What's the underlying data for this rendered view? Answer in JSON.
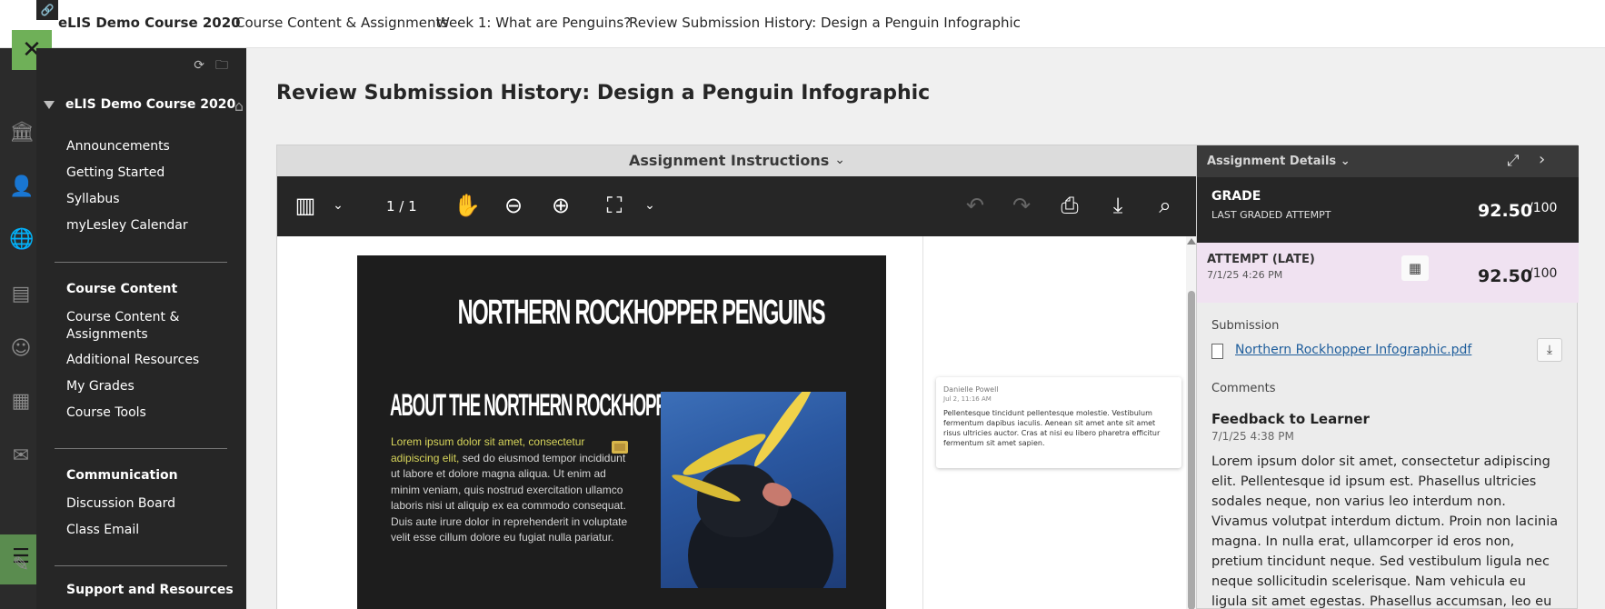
{
  "topbar": {
    "link_icon": "link-icon",
    "course": "eLIS Demo Course 2020",
    "crumbs": [
      "Course Content & Assignments",
      "Week 1: What are Penguins?",
      "Review Submission History: Design a Penguin Infographic"
    ]
  },
  "rail": {
    "icons": [
      "institution-icon",
      "profile-icon",
      "globe-icon",
      "activity-stream-icon",
      "groups-icon",
      "calendar-icon",
      "messages-icon",
      "courses-icon",
      "grades-icon"
    ],
    "close_glyph": "✕"
  },
  "menu": {
    "title": "eLIS Demo Course 2020",
    "items_top": [
      "Announcements",
      "Getting Started",
      "Syllabus",
      "myLesley Calendar"
    ],
    "section_course_content": "Course Content",
    "items_course_content": [
      "Course Content & Assignments",
      "Additional Resources",
      "My Grades",
      "Course Tools"
    ],
    "section_communication": "Communication",
    "items_communication": [
      "Discussion Board",
      "Class Email"
    ],
    "section_support": "Support and Resources"
  },
  "main": {
    "page_title": "Review Submission History: Design a Penguin Infographic"
  },
  "viewer": {
    "instructions_label": "Assignment Instructions",
    "page_indicator": "1 / 1",
    "poster": {
      "title": "NORTHERN ROCKHOPPER PENGUINS",
      "subtitle": "ABOUT THE NORTHERN ROCKHOPPER",
      "highlighted": "Lorem ipsum dolor sit amet, consectetur adipiscing elit,",
      "body": " sed do eiusmod tempor incididunt ut labore et dolore magna aliqua. Ut enim ad minim veniam, quis nostrud exercitation ullamco laboris nisi ut aliquip ex ea commodo consequat. Duis aute irure dolor in reprehenderit in voluptate velit esse cillum dolore eu fugiat nulla pariatur."
    },
    "comment": {
      "author": "Danielle Powell",
      "date": "Jul 2, 11:16 AM",
      "text": "Pellentesque tincidunt pellentesque molestie. Vestibulum fermentum dapibus iaculis. Aenean sit amet ante sit amet risus ultricies auctor. Cras at nisi eu libero pharetra efficitur fermentum sit amet sapien."
    }
  },
  "details": {
    "header": "Assignment Details",
    "grade_label": "GRADE",
    "grade_sub": "LAST GRADED ATTEMPT",
    "grade_value": "92.50",
    "grade_max": "/100",
    "attempt_label": "ATTEMPT (LATE)",
    "attempt_date": "7/1/25 4:26 PM",
    "attempt_value": "92.50",
    "attempt_max": "/100",
    "submission_label": "Submission",
    "file_name": "Northern Rockhopper Infographic.pdf",
    "comments_label": "Comments",
    "feedback_title": "Feedback to Learner",
    "feedback_date": "7/1/25 4:38 PM",
    "feedback_text": "Lorem ipsum dolor sit amet, consectetur adipiscing elit. Pellentesque id ipsum est. Phasellus ultricies sodales neque, non varius leo interdum non. Vivamus volutpat interdum dictum. Proin non lacinia magna. In nulla erat, ullamcorper id eros non, pretium tincidunt neque. Sed vestibulum ligula nec neque sollicitudin scelerisque. Nam vehicula eu ligula sit amet egestas. Phasellus accumsan, leo eu rhoncus facilisis, nisl nibh dictum velit,"
  }
}
